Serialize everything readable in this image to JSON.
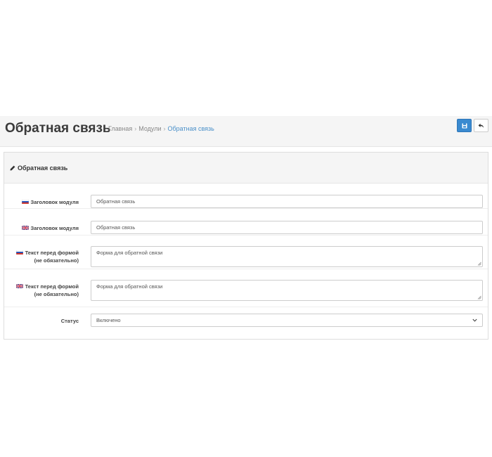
{
  "header": {
    "title": "Обратная связь",
    "breadcrumb": [
      "Главная",
      "Модули",
      "Обратная связь"
    ]
  },
  "toolbar": {
    "save_icon": "floppy-disk-icon",
    "back_icon": "reply-icon"
  },
  "panel": {
    "title": "Обратная связь",
    "icon": "pencil-icon"
  },
  "form": {
    "heading_ru": {
      "label": "Заголовок модуля",
      "flag": "ru-flag-icon",
      "value": "Обратная связь"
    },
    "heading_en": {
      "label": "Заголовок модуля",
      "flag": "gb-flag-icon",
      "value": "Обратная связь"
    },
    "text_ru": {
      "label_line1": "Текст перед формой",
      "label_line2": "(не обязательно)",
      "flag": "ru-flag-icon",
      "value": "Форма для обратной связи"
    },
    "text_en": {
      "label_line1": "Текст перед формой",
      "label_line2": "(не обязательно)",
      "flag": "gb-flag-icon",
      "value": "Форма для обратной связи"
    },
    "status": {
      "label": "Статус",
      "value": "Включено"
    }
  },
  "colors": {
    "primary": "#3a8ad0",
    "link": "#4a90c9"
  }
}
